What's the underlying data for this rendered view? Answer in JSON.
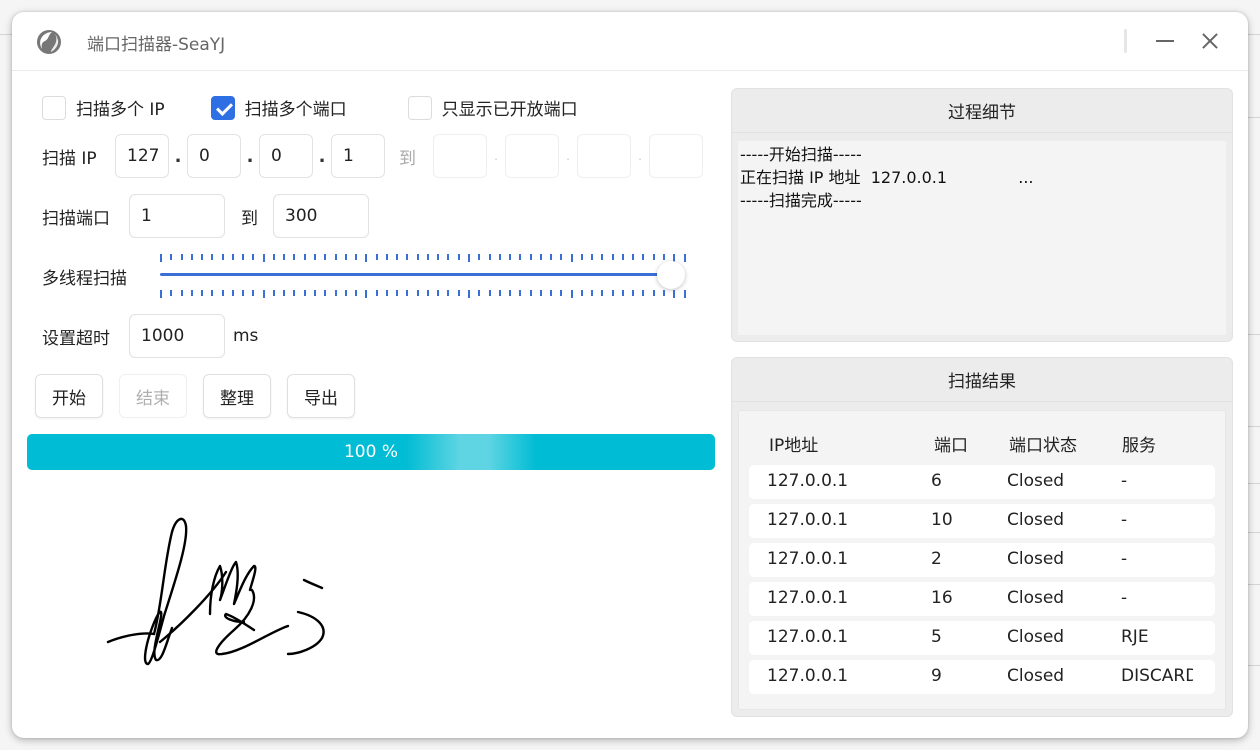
{
  "window": {
    "title": "端口扫描器-SeaYJ",
    "icon": "globe-icon",
    "controls": {
      "minimize": "minimize-icon",
      "close": "close-icon"
    }
  },
  "options": {
    "multi_ip": {
      "label": "扫描多个 IP",
      "checked": false
    },
    "multi_port": {
      "label": "扫描多个端口",
      "checked": true
    },
    "open_only": {
      "label": "只显示已开放端口",
      "checked": false
    }
  },
  "scan_ip": {
    "label": "扫描 IP",
    "start": [
      "127",
      "0",
      "0",
      "1"
    ],
    "to_label": "到",
    "end": [
      "",
      "",
      "",
      ""
    ],
    "separator": "."
  },
  "scan_port": {
    "label": "扫描端口",
    "start": "1",
    "to_label": "到",
    "end": "300"
  },
  "threads": {
    "label": "多线程扫描",
    "value_fraction": 1.0
  },
  "timeout": {
    "label": "设置超时",
    "value": "1000",
    "unit": "ms"
  },
  "buttons": {
    "start": "开始",
    "stop": "结束",
    "organize": "整理",
    "export": "导出"
  },
  "progress": {
    "percent": 100,
    "text": "100 %",
    "color": "#00bcd4"
  },
  "log_panel": {
    "title": "过程细节",
    "lines": [
      "-----开始扫描-----",
      "正在扫描 IP 地址  127.0.0.1              ...",
      "-----扫描完成-----"
    ]
  },
  "results_panel": {
    "title": "扫描结果",
    "columns": [
      "IP地址",
      "端口",
      "端口状态",
      "服务"
    ],
    "rows": [
      [
        "127.0.0.1",
        "6",
        "Closed",
        "-"
      ],
      [
        "127.0.0.1",
        "10",
        "Closed",
        "-"
      ],
      [
        "127.0.0.1",
        "2",
        "Closed",
        "-"
      ],
      [
        "127.0.0.1",
        "16",
        "Closed",
        "-"
      ],
      [
        "127.0.0.1",
        "5",
        "Closed",
        "RJE"
      ],
      [
        "127.0.0.1",
        "9",
        "Closed",
        "DISCARD"
      ]
    ]
  },
  "signature": {
    "kind": "handwritten-signature"
  }
}
